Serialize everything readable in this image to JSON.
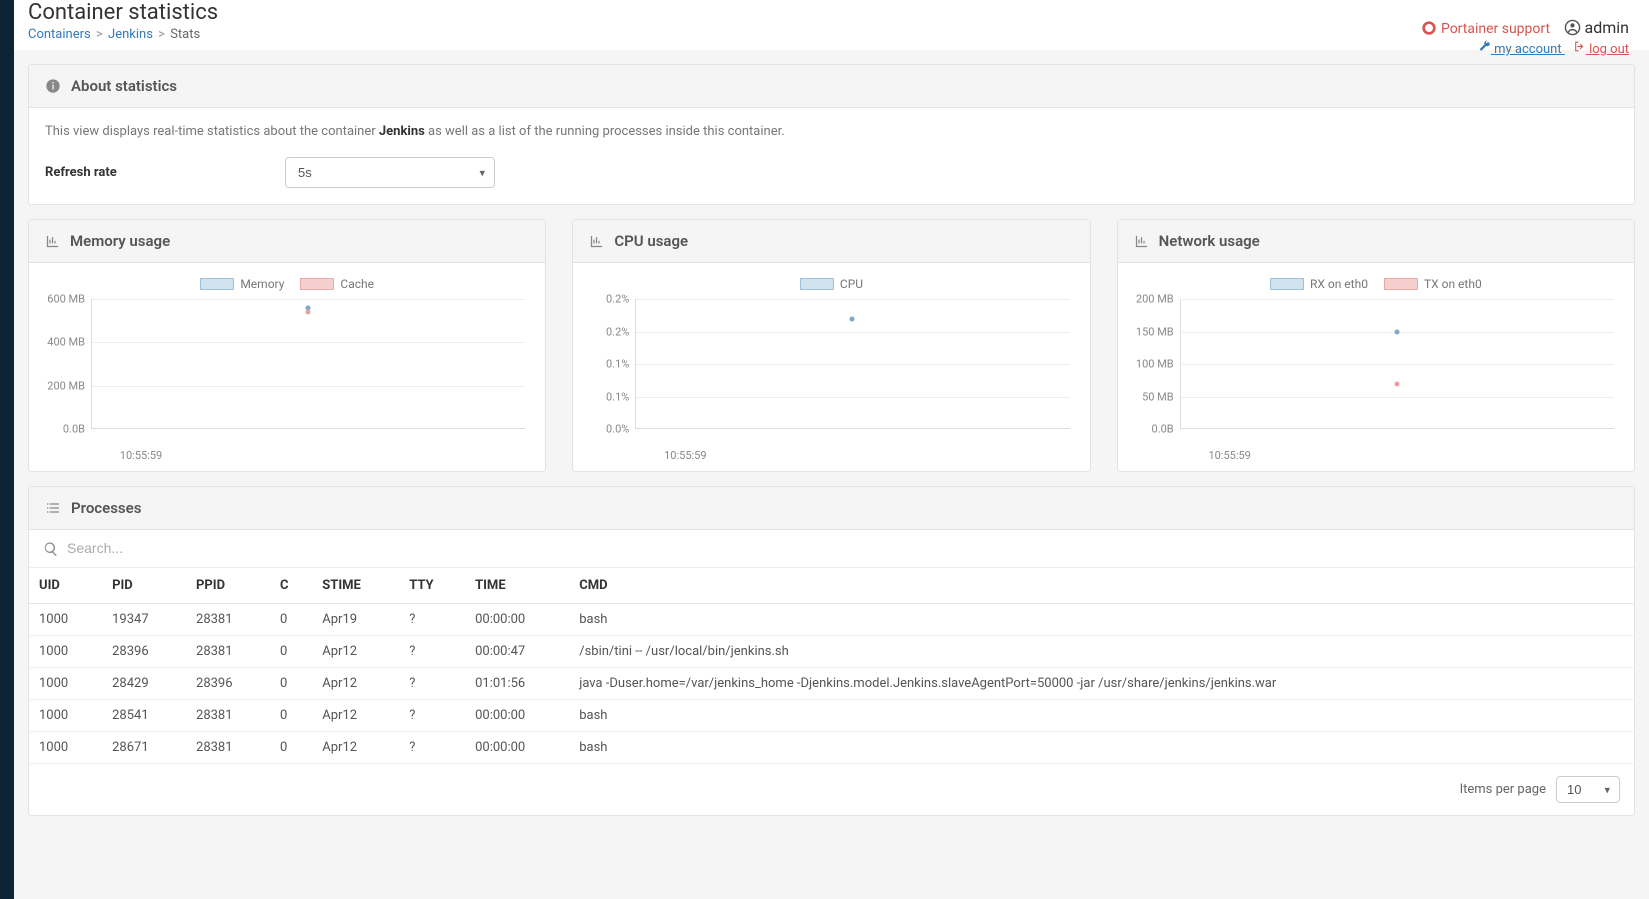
{
  "header": {
    "page_title": "Container statistics",
    "breadcrumb": {
      "item1": "Containers",
      "item2": "Jenkins",
      "item3": "Stats"
    },
    "support_label": "Portainer support",
    "user_label": "admin",
    "my_account": "my account",
    "log_out": "log out"
  },
  "about": {
    "title": "About statistics",
    "text_prefix": "This view displays real-time statistics about the container ",
    "text_bold": "Jenkins",
    "text_suffix": " as well as a list of the running processes inside this container.",
    "refresh_label": "Refresh rate",
    "refresh_value": "5s"
  },
  "charts": {
    "memory": {
      "title": "Memory usage",
      "legend1": "Memory",
      "legend2": "Cache",
      "yticks": [
        "600 MB",
        "400 MB",
        "200 MB",
        "0.0B"
      ],
      "xtick": "10:55:59"
    },
    "cpu": {
      "title": "CPU usage",
      "legend1": "CPU",
      "yticks": [
        "0.2%",
        "0.2%",
        "0.1%",
        "0.1%",
        "0.0%"
      ],
      "xtick": "10:55:59"
    },
    "network": {
      "title": "Network usage",
      "legend1": "RX on eth0",
      "legend2": "TX on eth0",
      "yticks": [
        "200 MB",
        "150 MB",
        "100 MB",
        "50 MB",
        "0.0B"
      ],
      "xtick": "10:55:59"
    }
  },
  "processes": {
    "title": "Processes",
    "search_placeholder": "Search...",
    "columns": [
      "UID",
      "PID",
      "PPID",
      "C",
      "STIME",
      "TTY",
      "TIME",
      "CMD"
    ],
    "rows": [
      [
        "1000",
        "19347",
        "28381",
        "0",
        "Apr19",
        "?",
        "00:00:00",
        "bash"
      ],
      [
        "1000",
        "28396",
        "28381",
        "0",
        "Apr12",
        "?",
        "00:00:47",
        "/sbin/tini -- /usr/local/bin/jenkins.sh"
      ],
      [
        "1000",
        "28429",
        "28396",
        "0",
        "Apr12",
        "?",
        "01:01:56",
        "java -Duser.home=/var/jenkins_home -Djenkins.model.Jenkins.slaveAgentPort=50000 -jar /usr/share/jenkins/jenkins.war"
      ],
      [
        "1000",
        "28541",
        "28381",
        "0",
        "Apr12",
        "?",
        "00:00:00",
        "bash"
      ],
      [
        "1000",
        "28671",
        "28381",
        "0",
        "Apr12",
        "?",
        "00:00:00",
        "bash"
      ]
    ],
    "items_per_page_label": "Items per page",
    "items_per_page_value": "10"
  },
  "chart_data": [
    {
      "type": "scatter",
      "title": "Memory usage",
      "xlabel": "",
      "ylabel": "",
      "x": [
        "10:55:59"
      ],
      "series": [
        {
          "name": "Memory",
          "values": [
            560
          ]
        },
        {
          "name": "Cache",
          "values": [
            540
          ]
        }
      ],
      "ylim": [
        0,
        600
      ],
      "y_unit": "MB"
    },
    {
      "type": "scatter",
      "title": "CPU usage",
      "xlabel": "",
      "ylabel": "",
      "x": [
        "10:55:59"
      ],
      "series": [
        {
          "name": "CPU",
          "values": [
            0.17
          ]
        }
      ],
      "ylim": [
        0,
        0.2
      ],
      "y_unit": "%"
    },
    {
      "type": "scatter",
      "title": "Network usage",
      "xlabel": "",
      "ylabel": "",
      "x": [
        "10:55:59"
      ],
      "series": [
        {
          "name": "RX on eth0",
          "values": [
            150
          ]
        },
        {
          "name": "TX on eth0",
          "values": [
            70
          ]
        }
      ],
      "ylim": [
        0,
        200
      ],
      "y_unit": "MB"
    }
  ]
}
